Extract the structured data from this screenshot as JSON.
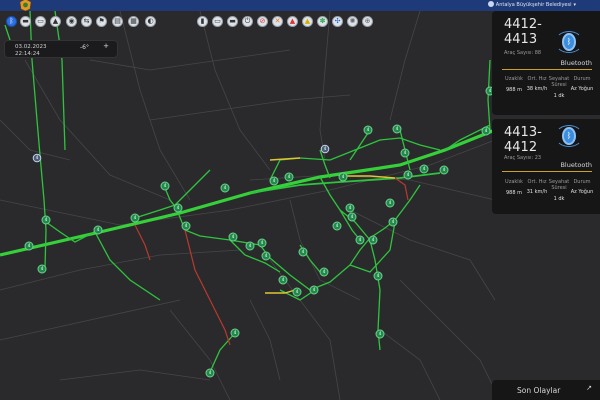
{
  "header": {
    "municipality": "Antalya Büyükşehir Belediyesi",
    "bar_color": "#1f3a78"
  },
  "toolbar": {
    "left": [
      {
        "name": "bluetooth-layer-icon",
        "glyph": "ᛒ",
        "active": true
      },
      {
        "name": "folder-icon",
        "glyph": "▬"
      },
      {
        "name": "car-icon",
        "glyph": "▭"
      },
      {
        "name": "camera-icon",
        "glyph": "▲"
      },
      {
        "name": "speed-icon",
        "glyph": "◉"
      },
      {
        "name": "route-icon",
        "glyph": "⇆"
      },
      {
        "name": "flag-icon",
        "glyph": "⚑"
      },
      {
        "name": "gauge-icon",
        "glyph": "◐"
      }
    ],
    "right": [
      {
        "name": "display-icon",
        "glyph": "▮"
      },
      {
        "name": "monitor-icon",
        "glyph": "▭"
      },
      {
        "name": "screen-icon",
        "glyph": "▬"
      },
      {
        "name": "power-icon",
        "glyph": "⏻"
      },
      {
        "name": "no-entry-icon",
        "glyph": "⊘",
        "color": "red"
      },
      {
        "name": "cross-icon",
        "glyph": "✕",
        "color": "orange"
      },
      {
        "name": "warning-icon",
        "glyph": "▲",
        "color": "red"
      },
      {
        "name": "caution-icon",
        "glyph": "▲",
        "color": "yellow"
      },
      {
        "name": "network-icon",
        "glyph": "✽",
        "color": "green"
      },
      {
        "name": "compass-icon",
        "glyph": "✣",
        "color": "blue"
      },
      {
        "name": "settings-icon",
        "glyph": "✺",
        "color": "gray"
      },
      {
        "name": "target-icon",
        "glyph": "⊕",
        "color": "gray"
      }
    ]
  },
  "datebox": {
    "date": "03.02.2023",
    "time": "22:14:24",
    "temperature": "-6°",
    "add": "+"
  },
  "cards": [
    {
      "route_id": "4412-4413",
      "count_label": "Araç Sayısı: 88",
      "source": "Bluetooth",
      "headers": [
        "Uzaklık",
        "Ort. Hız",
        "Seyahat Süresi",
        "Durum"
      ],
      "values": [
        "988 m",
        "38 km/h",
        "1 dk",
        "Az Yoğun"
      ]
    },
    {
      "route_id": "4413-4412",
      "count_label": "Araç Sayısı: 23",
      "source": "Bluetooth",
      "headers": [
        "Uzaklık",
        "Ort. Hız",
        "Seyahat Süresi",
        "Durum"
      ],
      "values": [
        "988 m",
        "31 km/h",
        "1 dk",
        "Az Yoğun"
      ]
    }
  ],
  "events": {
    "label": "Son Olaylar",
    "arrow": "↗"
  },
  "map": {
    "background": "#2a2a2c",
    "traffic_colors": {
      "free": "#2fc43e",
      "moderate": "#e0c631",
      "heavy": "#c0392b"
    }
  }
}
